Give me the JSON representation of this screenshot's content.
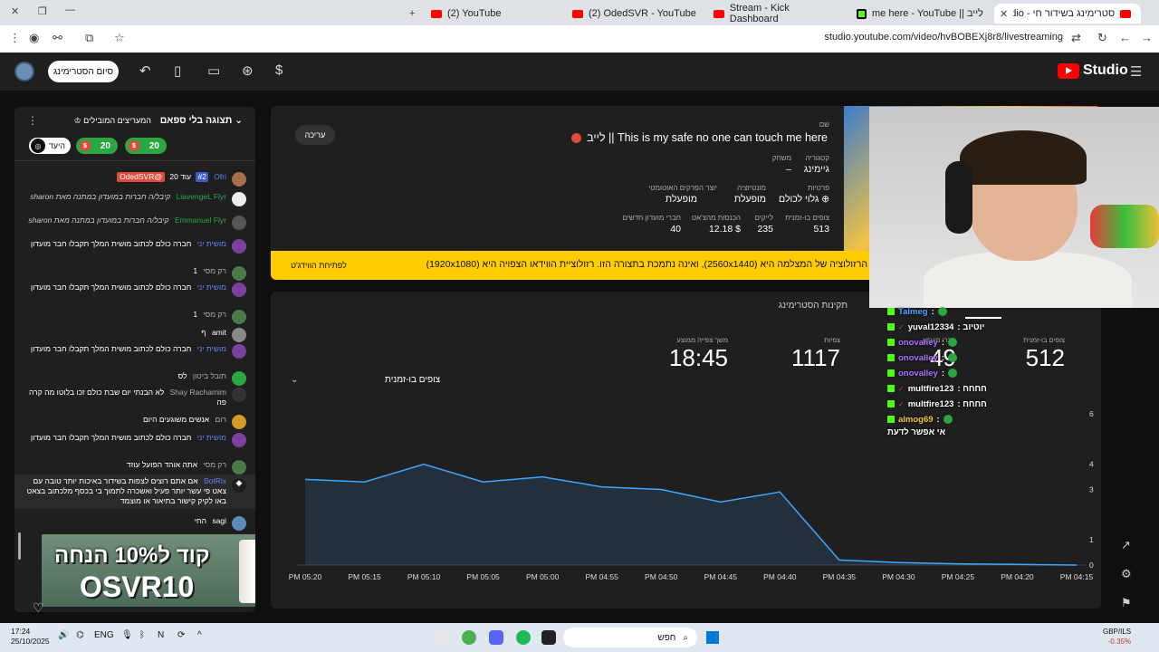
{
  "browser": {
    "tabs": [
      {
        "label": "(2) YouTube",
        "icon": "youtube-icon"
      },
      {
        "label": "(2) OdedSVR - YouTube",
        "icon": "youtube-icon"
      },
      {
        "label": "Stream - Kick Dashboard",
        "icon": "kick-icon"
      },
      {
        "label": "me here - YouTube || לייב",
        "icon": "youtube-icon"
      },
      {
        "label": "סטרימינג בשידור חי - be Studio",
        "icon": "youtube-icon"
      }
    ],
    "url": "studio.youtube.com/video/hvBOBEXj8r8/livestreaming"
  },
  "header": {
    "end_stream_label": "סיום הסטרימינג",
    "logo_text": "Studio"
  },
  "chat": {
    "title": "תצוגה בלי ספאם",
    "top_label": "המעריצים המובילים",
    "pills": [
      "20",
      "20"
    ],
    "goal_label": "היעד",
    "messages": [
      {
        "author": "Ofri",
        "text": "עוד 20",
        "chip": "@OdedSVR",
        "rank": "#2",
        "type": "mod"
      },
      {
        "author": "LiavengeL Flyr",
        "text": "קיבל/ה חברות במועדון במתנה מאת sharon",
        "type": "gift"
      },
      {
        "author": "Emmanuel Flyr",
        "text": "קיבל/ה חברות במועדון במתנה מאת sharon",
        "type": "gift"
      },
      {
        "author": "מושית יני",
        "text": "חברה כולם לכתוב מושית המלך תקבלו חבר מועדון",
        "type": "mod"
      },
      {
        "author": "רק מסי",
        "text": "1",
        "type": "normal"
      },
      {
        "author": "מושית יני",
        "text": "חברה כולם לכתוב מושית המלך תקבלו חבר מועדון",
        "type": "mod"
      },
      {
        "author": "רק מסי",
        "text": "1",
        "type": "normal"
      },
      {
        "author": "amit",
        "text": "ף",
        "type": "normal"
      },
      {
        "author": "מושית יני",
        "text": "חברה כולם לכתוב מושית המלך תקבלו חבר מועדון",
        "type": "mod"
      },
      {
        "author": "תובל ביטון",
        "text": "לס",
        "type": "normal"
      },
      {
        "author": "Shay Rachamim",
        "text": "לא הבנתי יום שבת כולם זכו בלוטו מה קרה פה",
        "type": "normal"
      },
      {
        "author": "רום",
        "text": "אנשים משוגעים היום",
        "type": "normal"
      },
      {
        "author": "מושית יני",
        "text": "חברה כולם לכתוב מושית המלך תקבלו חבר מועדון",
        "type": "mod"
      },
      {
        "author": "רק מסי",
        "text": "אתה אוהד הפועל עוזד",
        "type": "normal"
      },
      {
        "author": "BotRix",
        "text": "אם אתם רוצים לצפות בשידור באיכות יותר טובה עם צאט פי עשר יותר פעיל ואשכרה לתמוך בי בכסף מלכתוב בצאט באו לקיק קישור בתיאור או מוצמד",
        "type": "bot"
      },
      {
        "author": "sagi",
        "text": "החי",
        "type": "normal"
      }
    ],
    "ad": {
      "line1": "קוד ל10% הנחה",
      "line2": "OSVR10"
    }
  },
  "stream": {
    "edit_label": "עריכה",
    "name_label": "שם",
    "title": "This is my safe no one can touch me here || לייב",
    "category_label": "קטגוריה",
    "category": "גיימינג",
    "game_label": "משחק",
    "game": "–",
    "privacy_label": "פרטיות",
    "privacy": "גלוי לכולם",
    "monetization_label": "מונטיזציה",
    "monetization": "מופעלת",
    "autochapters_label": "יוצר הפרקים האוטומטי",
    "autochapters": "מופעלת",
    "concurrent_label": "צופים בו-זמנית",
    "concurrent": "513",
    "likes_label": "לייקים",
    "likes": "235",
    "superchat_label": "הכנסות מהצ'אט",
    "superchat": "$ 12.18",
    "members_label": "חברי מועדון חדשים",
    "members": "40",
    "warning": "הרזולוציה של המצלמה היא (2560x1440), ואינה נתמכת בתצורה הזו. רזולוציית הווידאו הצפויה היא (1920x1080)",
    "warning_button": "לפתיחת הווידג'ט"
  },
  "stats": {
    "title": "תקינות הסטרימינג",
    "concurrent_label": "צופים בו-זמנית",
    "concurrent": "512",
    "members_label": "חברי מועדון",
    "members": "49",
    "views_label": "צפיות",
    "views": "1117",
    "avg_label": "משך צפייה ממוצע",
    "avg": "18:45",
    "dropdown_label": "צופים בו-זמנית"
  },
  "chart_data": {
    "type": "area",
    "x": [
      "PM 05:20",
      "PM 05:15",
      "PM 05:10",
      "PM 05:05",
      "PM 05:00",
      "PM 04:55",
      "PM 04:50",
      "PM 04:45",
      "PM 04:40",
      "PM 04:35",
      "PM 04:30",
      "PM 04:25",
      "PM 04:20",
      "PM 04:15"
    ],
    "ylabel": "",
    "y_ticks": [
      "6",
      "4",
      "3",
      "1",
      "0"
    ],
    "series": [
      {
        "values": [
          3.4,
          3.3,
          4.0,
          3.3,
          3.5,
          3.1,
          3.0,
          2.5,
          2.9,
          0.2,
          0.1,
          0.05,
          0.03,
          0.0
        ]
      }
    ],
    "ylim": [
      0,
      6
    ]
  },
  "kick": {
    "messages": [
      {
        "user": "Talmeg",
        "text": ":",
        "color": "#4aa3ff"
      },
      {
        "user": "yuval12334",
        "text": ": יוטיוב",
        "color": "#ffffff"
      },
      {
        "user": "onovalley",
        "text": ":",
        "color": "#b16cff"
      },
      {
        "user": "onovalley",
        "text": ":",
        "color": "#b16cff"
      },
      {
        "user": "onovalley",
        "text": ":",
        "color": "#b16cff"
      },
      {
        "user": "multfire123",
        "text": ": חחחח",
        "color": "#ffffff"
      },
      {
        "user": "multfire123",
        "text": ": חחחח",
        "color": "#ffffff"
      },
      {
        "user": "almog69",
        "text": ":",
        "color": "#f5c542"
      }
    ],
    "bottom_text": "אי אפשר לדעת"
  },
  "taskbar": {
    "time": "17:24",
    "date": "25/10/2025",
    "lang": "ENG",
    "search": "חפש",
    "currency": "GBP/ILS",
    "change": "-0.35%"
  }
}
